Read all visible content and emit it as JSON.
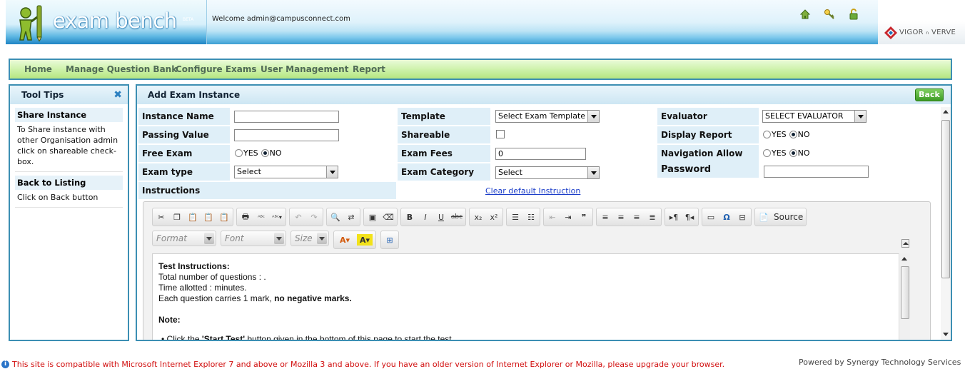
{
  "header": {
    "logo_text": "exam bench",
    "logo_badge": "BETA",
    "welcome": "Welcome admin@campusconnect.com",
    "icons": [
      "home-icon",
      "key-icon",
      "lock-icon"
    ],
    "partner_logo": "VIGOR",
    "partner_logo_n": "n",
    "partner_logo_2": "VERVE"
  },
  "nav": {
    "items": [
      "Home",
      "Manage Question Bank",
      "Configure Exams",
      "User Management",
      "Report"
    ]
  },
  "tips": {
    "title": "Tool Tips",
    "close_icon": "close-icon",
    "blocks": [
      {
        "title": "Share Instance",
        "body": "To Share instance with other Organisation admin click on shareable check-box."
      },
      {
        "title": "Back to Listing",
        "body": "Click on Back button"
      }
    ]
  },
  "form": {
    "title": "Add Exam Instance",
    "back_label": "Back",
    "instance_name_label": "Instance Name",
    "instance_name_value": "",
    "passing_value_label": "Passing Value",
    "passing_value_value": "",
    "free_exam_label": "Free Exam",
    "free_exam_yes": "YES",
    "free_exam_no": "NO",
    "free_exam_selected": "NO",
    "exam_type_label": "Exam type",
    "exam_type_value": "Select",
    "template_label": "Template",
    "template_value": "Select Exam Template",
    "shareable_label": "Shareable",
    "shareable_checked": false,
    "exam_fees_label": "Exam Fees",
    "exam_fees_value": "0",
    "exam_category_label": "Exam Category",
    "exam_category_value": "Select",
    "evaluator_label": "Evaluator",
    "evaluator_value": "SELECT EVALUATOR",
    "display_report_label": "Display Report",
    "display_report_yes": "YES",
    "display_report_no": "NO",
    "display_report_selected": "NO",
    "navigation_label": "Navigation Allow",
    "navigation_yes": "YES",
    "navigation_no": "NO",
    "navigation_selected": "NO",
    "password_label": "Password",
    "password_value": "",
    "instructions_label": "Instructions",
    "clear_link": "Clear default Instruction"
  },
  "editor": {
    "source_label": "Source",
    "format_placeholder": "Format",
    "font_placeholder": "Font",
    "size_placeholder": "Size",
    "content": {
      "heading": "Test Instructions:",
      "line1": "Total number of questions : .",
      "line2": "Time allotted : minutes.",
      "line3_prefix": "Each question carries 1 mark, ",
      "line3_bold": "no negative marks.",
      "note": "Note:",
      "bullet_prefix": "Click the ",
      "bullet_bold": "'Start Test'",
      "bullet_suffix": " button given in the bottom of this page to start the test."
    }
  },
  "footer": {
    "warning": "This site is compatible with Microsoft Internet Explorer 7 and above or Mozilla 3 and above. If you have an older version of Internet Explorer or Mozilla, please upgrade your browser.",
    "powered": "Powered by Synergy Technology Services"
  },
  "colors": {
    "panel_border": "#3c8fb3",
    "nav_bg": "#c9f0a3",
    "label_bg": "#dfeff8",
    "back_button": "#3e9b25",
    "warning_text": "#d10d0d"
  }
}
